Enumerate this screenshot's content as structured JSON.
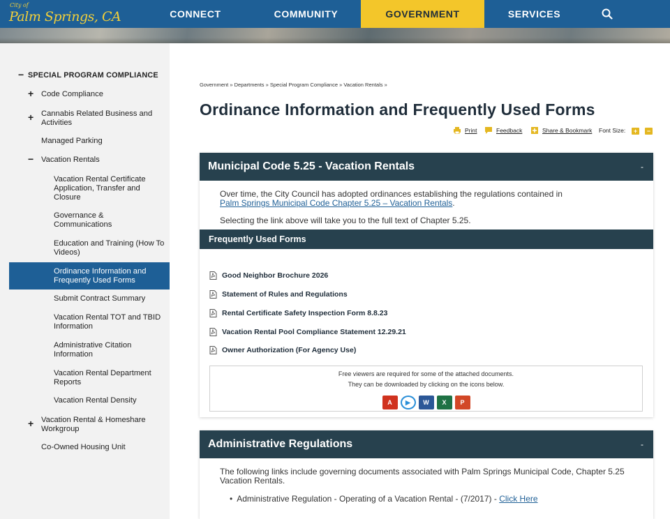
{
  "header": {
    "logo_small": "City of",
    "logo_big": "Palm Springs, CA",
    "nav": [
      {
        "label": "CONNECT"
      },
      {
        "label": "COMMUNITY"
      },
      {
        "label": "GOVERNMENT",
        "active": true
      },
      {
        "label": "SERVICES"
      }
    ],
    "search_icon": "search-icon"
  },
  "sidebar": {
    "section": {
      "sign": "−",
      "label": "SPECIAL PROGRAM COMPLIANCE"
    },
    "items": [
      {
        "sign": "+",
        "label": "Code Compliance"
      },
      {
        "sign": "+",
        "label": "Cannabis Related Business and Activities"
      },
      {
        "sign": "",
        "label": "Managed Parking"
      },
      {
        "sign": "−",
        "label": "Vacation Rentals"
      }
    ],
    "subitems": [
      {
        "label": "Vacation Rental Certificate Application, Transfer and Closure"
      },
      {
        "label": "Governance & Communications"
      },
      {
        "label": "Education and Training (How To Videos)"
      },
      {
        "label": "Ordinance Information and Frequently Used Forms",
        "active": true
      },
      {
        "label": "Submit Contract Summary"
      },
      {
        "label": "Vacation Rental TOT and TBID Information"
      },
      {
        "label": "Administrative Citation Information"
      },
      {
        "label": "Vacation Rental Department Reports"
      },
      {
        "label": "Vacation Rental Density"
      }
    ],
    "tail": [
      {
        "sign": "+",
        "label": "Vacation Rental & Homeshare Workgroup"
      },
      {
        "sign": "",
        "label": "Co-Owned Housing Unit"
      }
    ]
  },
  "breadcrumb": "Government » Departments » Special Program Compliance » Vacation Rentals »",
  "page_title": "Ordinance Information and Frequently Used Forms",
  "tools": {
    "print": "Print",
    "feedback": "Feedback",
    "share": "Share & Bookmark",
    "font_size": "Font Size:",
    "increase": "+",
    "decrease": "−",
    "colors": {
      "icon": "#e4b721"
    }
  },
  "municipal": {
    "title": "Municipal Code 5.25 - Vacation Rentals",
    "toggle": "-",
    "p1_text": "Over time, the City Council has adopted ordinances establishing the regulations contained in",
    "p1_link": "Palm Springs Municipal Code Chapter 5.25 – Vacation Rentals",
    "p1_end": ".",
    "p2": "Selecting the link above will take you to the full text of Chapter 5.25.",
    "forms_title": "Frequently Used Forms",
    "forms": [
      "Good Neighbor Brochure 2026",
      "Statement of Rules and Regulations",
      "Rental Certificate Safety Inspection Form 8.8.23",
      "Vacation Rental Pool Compliance Statement 12.29.21",
      "Owner Authorization (For Agency Use)"
    ],
    "viewers_line1": "Free viewers are required for some of the attached documents.",
    "viewers_line2": "They can be downloaded by clicking on the icons below.",
    "viewer_icons": [
      {
        "name": "adobe-reader-icon",
        "glyph": "A",
        "color": "#d0321e"
      },
      {
        "name": "media-player-icon",
        "glyph": "▶",
        "color": "#2a8fd8"
      },
      {
        "name": "word-viewer-icon",
        "glyph": "W",
        "color": "#2b5797"
      },
      {
        "name": "excel-viewer-icon",
        "glyph": "X",
        "color": "#1f7244"
      },
      {
        "name": "powerpoint-viewer-icon",
        "glyph": "P",
        "color": "#d24726"
      }
    ]
  },
  "admin": {
    "title": "Administrative Regulations",
    "toggle": "-",
    "p1": "The following links include governing documents associated with Palm Springs Municipal Code, Chapter 5.25 Vacation Rentals.",
    "bullet": "Administrative Regulation - Operating of a Vacation Rental - (7/2017)  -",
    "bullet_link": "Click Here"
  }
}
